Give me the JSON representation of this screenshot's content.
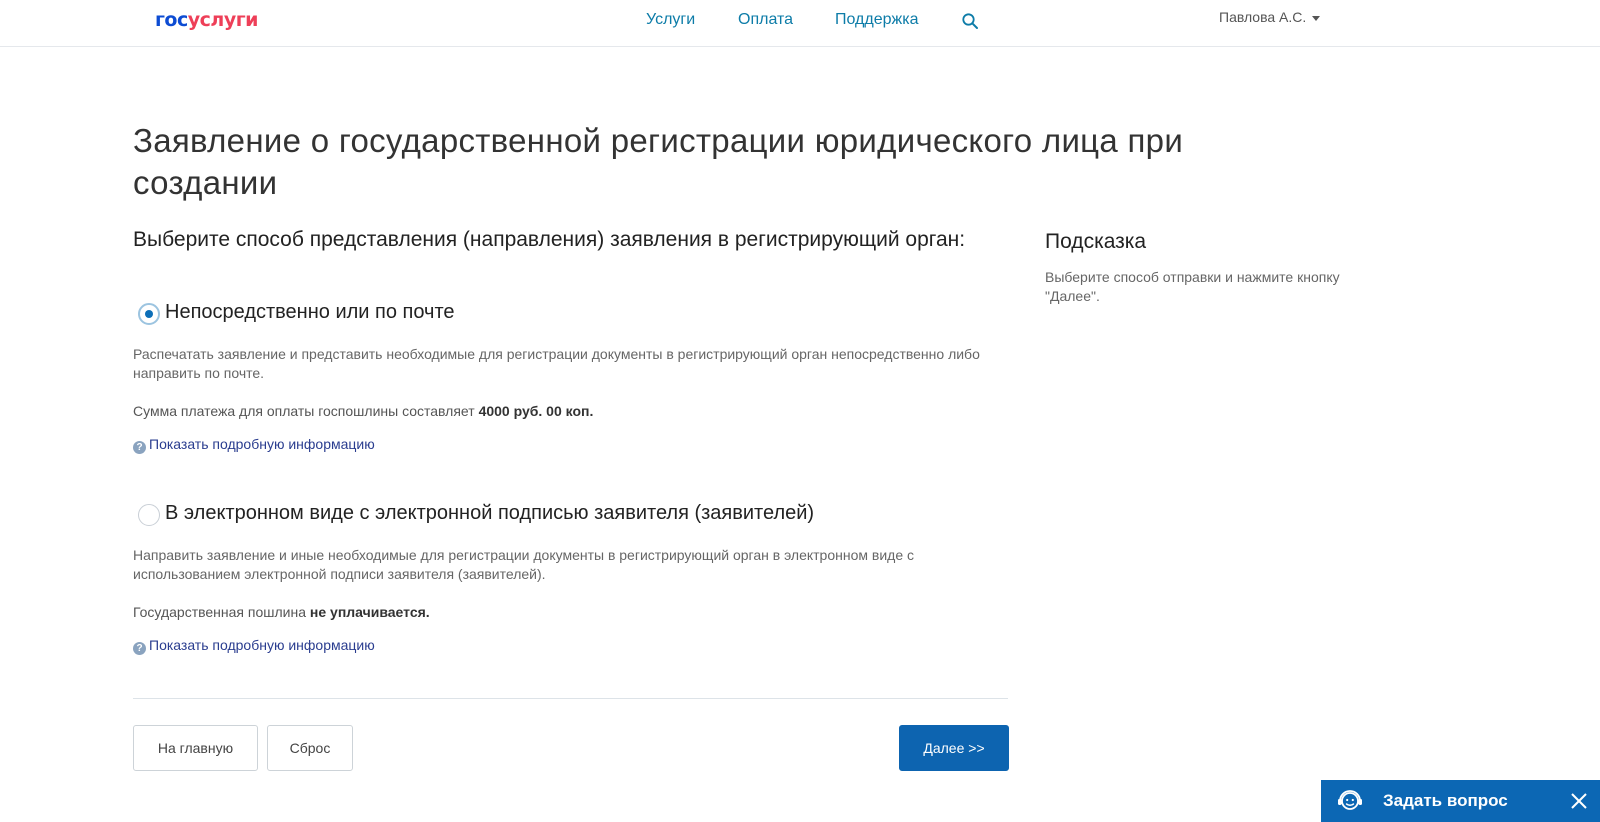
{
  "header": {
    "logo_part1": "гос",
    "logo_part2": "услуги",
    "nav": [
      "Услуги",
      "Оплата",
      "Поддержка"
    ],
    "user": "Павлова А.С."
  },
  "page": {
    "title": "Заявление о государственной регистрации юридического лица при создании",
    "question": "Выберите способ представления (направления) заявления в регистрирующий орган:"
  },
  "options": [
    {
      "label": "Непосредственно или по почте",
      "selected": true,
      "description": "Распечатать заявление и представить необходимые для регистрации документы в регистрирующий орган непосредственно либо направить по почте.",
      "fee_text": "Сумма платежа для оплаты госпошлины составляет",
      "fee_value": "4000 руб. 00 коп.",
      "more_link": "Показать подробную информацию"
    },
    {
      "label": "В электронном виде с электронной подписью заявителя (заявителей)",
      "selected": false,
      "description": "Направить заявление и иные необходимые для регистрации документы в регистрирующий орган в электронном виде с использованием электронной подписи заявителя (заявителей).",
      "fee_text": "Государственная пошлина",
      "fee_value": "не уплачивается.",
      "more_link": "Показать подробную информацию"
    }
  ],
  "buttons": {
    "home": "На главную",
    "reset": "Сброс",
    "next": "Далее >>"
  },
  "hint": {
    "title": "Подсказка",
    "text": "Выберите способ отправки и нажмите кнопку \"Далее\"."
  },
  "chat": {
    "label": "Задать вопрос"
  },
  "colors": {
    "logo_blue": "#0d4cd3",
    "logo_red": "#ee3f58",
    "nav_link": "#0d7ca8",
    "primary_button": "#0d64b0",
    "chat_bar": "#0c67b4"
  }
}
